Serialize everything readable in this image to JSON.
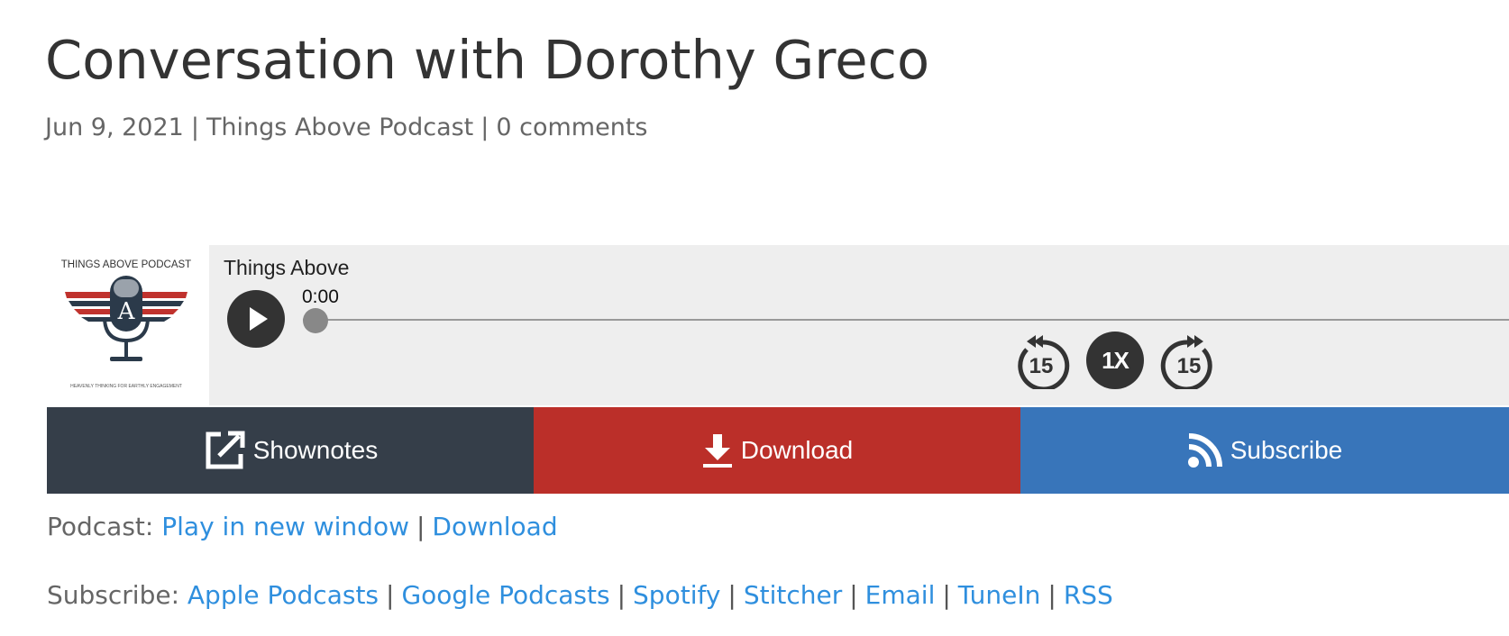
{
  "post": {
    "title": "Conversation with Dorothy Greco",
    "date": "Jun 9, 2021",
    "sep": "|",
    "category": "Things Above Podcast",
    "comments": "0 comments"
  },
  "player": {
    "cover": {
      "top_text": "THINGS ABOVE PODCAST",
      "tagline": "HEAVENLY THINKING FOR EARTHLY ENGAGEMENT",
      "monogram": "A"
    },
    "show_title": "Things Above",
    "time": "0:00",
    "rewind_label": "15",
    "speed_label": "1X",
    "forward_label": "15",
    "progress": 0
  },
  "actions": {
    "shownotes": "Shownotes",
    "download": "Download",
    "subscribe": "Subscribe"
  },
  "podcast_links": {
    "label": "Podcast:",
    "play_new_window": "Play in new window",
    "sep": "|",
    "download": "Download"
  },
  "subscribe_links": {
    "label": "Subscribe:",
    "sep": "|",
    "items": [
      "Apple Podcasts",
      "Google Podcasts",
      "Spotify",
      "Stitcher",
      "Email",
      "TuneIn",
      "RSS"
    ]
  },
  "colors": {
    "shownotes_bg": "#353e49",
    "download_bg": "#bb2f29",
    "subscribe_bg": "#3875ba",
    "link": "#2f8fde",
    "player_bg": "#eeeeee"
  },
  "icons": {
    "shownotes": "external-link-icon",
    "download": "download-icon",
    "subscribe": "rss-icon",
    "play": "play-icon",
    "rewind": "rewind-15-icon",
    "forward": "forward-15-icon"
  }
}
